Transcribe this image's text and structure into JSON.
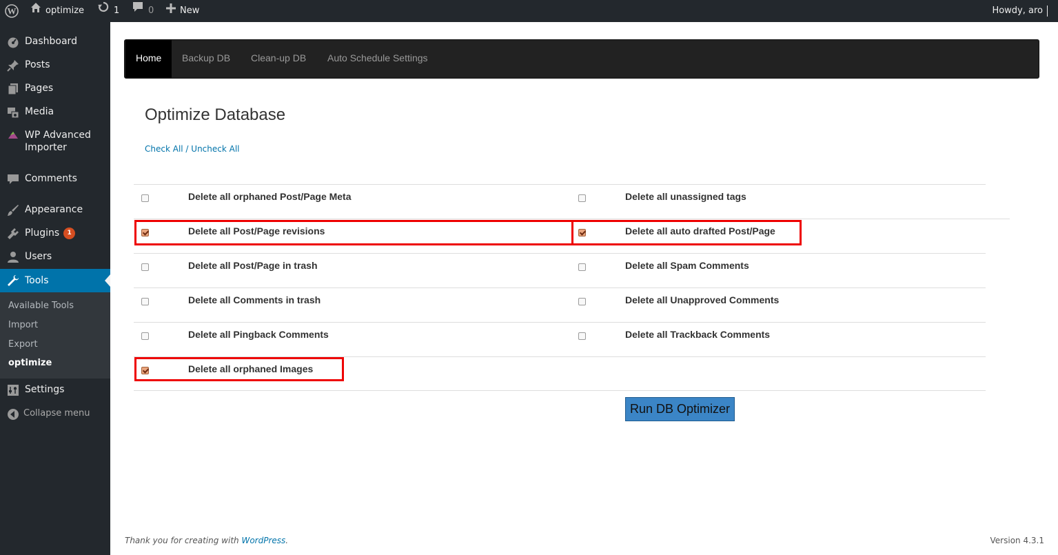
{
  "adminbar": {
    "site_name": "optimize",
    "updates_count": "1",
    "comments_count": "0",
    "new_label": "New",
    "howdy": "Howdy, aro"
  },
  "sidebar": {
    "items": [
      {
        "label": "Dashboard",
        "icon": "dashboard-icon"
      },
      {
        "label": "Posts",
        "icon": "pin-icon"
      },
      {
        "label": "Pages",
        "icon": "pages-icon"
      },
      {
        "label": "Media",
        "icon": "media-icon"
      },
      {
        "label": "WP Advanced Importer",
        "icon": "importer-icon"
      },
      {
        "label": "Comments",
        "icon": "comment-icon"
      },
      {
        "label": "Appearance",
        "icon": "brush-icon"
      },
      {
        "label": "Plugins",
        "icon": "plug-icon",
        "badge": "1"
      },
      {
        "label": "Users",
        "icon": "user-icon"
      },
      {
        "label": "Tools",
        "icon": "wrench-icon"
      },
      {
        "label": "Settings",
        "icon": "settings-icon"
      },
      {
        "label": "Collapse menu",
        "icon": "collapse-icon"
      }
    ],
    "tools_sub": [
      "Available Tools",
      "Import",
      "Export",
      "optimize"
    ]
  },
  "plugin_nav": {
    "tabs": [
      "Home",
      "Backup DB",
      "Clean-up DB",
      "Auto Schedule Settings"
    ]
  },
  "main": {
    "title": "Optimize Database",
    "check_all": "Check All",
    "separator": " / ",
    "uncheck_all": "Uncheck All",
    "options": [
      {
        "label": "Delete all orphaned Post/Page Meta",
        "checked": false
      },
      {
        "label": "Delete all unassigned tags",
        "checked": false
      },
      {
        "label": "Delete all Post/Page revisions",
        "checked": true
      },
      {
        "label": "Delete all auto drafted Post/Page",
        "checked": true
      },
      {
        "label": "Delete all Post/Page in trash",
        "checked": false
      },
      {
        "label": "Delete all Spam Comments",
        "checked": false
      },
      {
        "label": "Delete all Comments in trash",
        "checked": false
      },
      {
        "label": "Delete all Unapproved Comments",
        "checked": false
      },
      {
        "label": "Delete all Pingback Comments",
        "checked": false
      },
      {
        "label": "Delete all Trackback Comments",
        "checked": false
      },
      {
        "label": "Delete all orphaned Images",
        "checked": true
      }
    ],
    "run_button": "Run DB Optimizer"
  },
  "footer": {
    "thanks_prefix": "Thank you for creating with ",
    "wordpress_link": "WordPress",
    "thanks_suffix": ".",
    "version": "Version 4.3.1"
  },
  "colors": {
    "adminbar_bg": "#23282d",
    "active_menu": "#0073aa",
    "highlight": "#ee0000",
    "run_button": "#3b85c6"
  }
}
